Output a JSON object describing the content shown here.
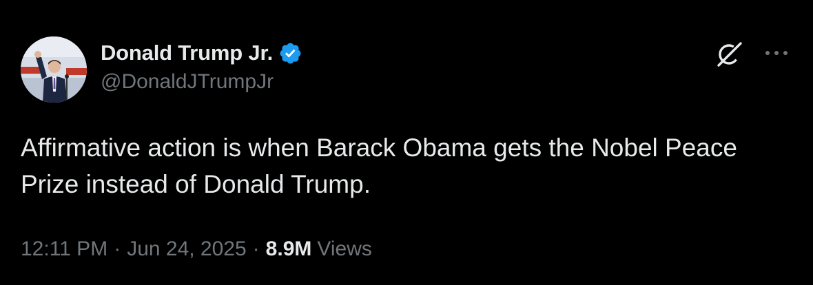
{
  "tweet": {
    "author": {
      "display_name": "Donald Trump Jr.",
      "handle": "@DonaldJTrumpJr",
      "verified": true
    },
    "text": "Affirmative action is when Barack Obama gets the Nobel Peace Prize instead of Donald Trump.",
    "time": "12:11 PM",
    "date": "Jun 24, 2025",
    "separator": "·",
    "views_count": "8.9M",
    "views_label": "Views"
  },
  "icons": {
    "verified": "verified-badge-icon",
    "grok": "grok-icon",
    "more": "more-options-icon"
  },
  "colors": {
    "background": "#000000",
    "primary_text": "#e7e9ea",
    "secondary_text": "#71767b",
    "verified_blue": "#1d9bf0"
  }
}
